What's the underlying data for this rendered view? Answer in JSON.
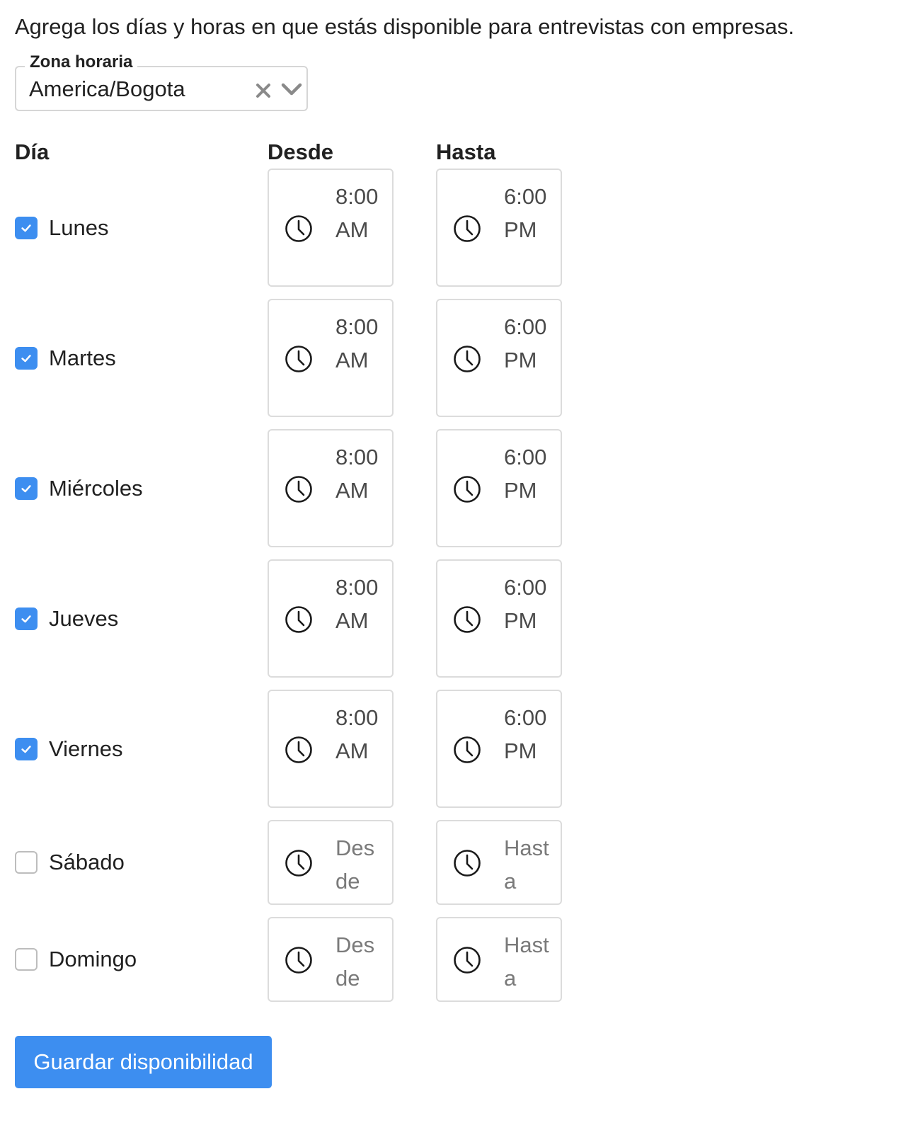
{
  "intro_text": "Agrega los días y horas en que estás disponible para entrevistas con empresas.",
  "timezone": {
    "label": "Zona horaria",
    "value": "America/Bogota",
    "clear_icon": "close-icon",
    "dropdown_icon": "chevron-down-icon"
  },
  "columns": {
    "day": "Día",
    "from": "Desde",
    "to": "Hasta"
  },
  "days": [
    {
      "name": "Lunes",
      "checked": true,
      "from": "8:00 AM",
      "to": "6:00 PM"
    },
    {
      "name": "Martes",
      "checked": true,
      "from": "8:00 AM",
      "to": "6:00 PM"
    },
    {
      "name": "Miércoles",
      "checked": true,
      "from": "8:00 AM",
      "to": "6:00 PM"
    },
    {
      "name": "Jueves",
      "checked": true,
      "from": "8:00 AM",
      "to": "6:00 PM"
    },
    {
      "name": "Viernes",
      "checked": true,
      "from": "8:00 AM",
      "to": "6:00 PM"
    },
    {
      "name": "Sábado",
      "checked": false,
      "from": "",
      "to": ""
    },
    {
      "name": "Domingo",
      "checked": false,
      "from": "",
      "to": ""
    }
  ],
  "placeholders": {
    "from": "Desde",
    "to": "Hasta"
  },
  "save_button": "Guardar disponibilidad",
  "colors": {
    "accent": "#3d8ef0",
    "border": "#dcdcdc",
    "text": "#212121"
  },
  "icons": {
    "time": "clock-icon",
    "checkbox": "checkmark-icon"
  }
}
